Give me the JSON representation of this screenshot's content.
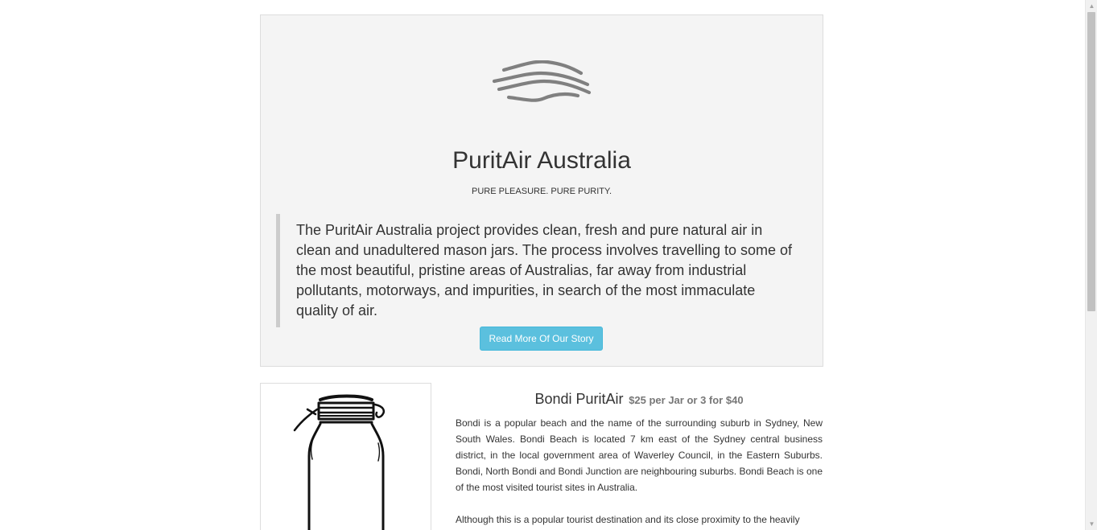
{
  "hero": {
    "logo_icon": "wind-waves-icon",
    "title": "PuritAir Australia",
    "tagline": "PURE PLEASURE. PURE PURITY.",
    "quote": "The PuritAir Australia project provides clean, fresh and pure natural air in clean and unadultered mason jars. The process involves travelling to some of the most beautiful, pristine areas of Australias, far away from industrial pollutants, motorways, and impurities, in search of the most immaculate quality of air.",
    "button_label": "Read More Of Our Story",
    "button_color": "#5bc0de"
  },
  "product": {
    "image_icon": "mason-jar-icon",
    "name": "Bondi PuritAir",
    "price": "$25 per Jar or 3 for $40",
    "paragraphs": [
      "Bondi is a popular beach and the name of the surrounding suburb in Sydney, New South Wales. Bondi Beach is located 7 km east of the Sydney central business district, in the local government area of Waverley Council, in the Eastern Suburbs. Bondi, North Bondi and Bondi Junction are neighbouring suburbs. Bondi Beach is one of the most visited tourist sites in Australia.",
      "Although this is a popular tourist destination and its close proximity to the heavily"
    ]
  }
}
